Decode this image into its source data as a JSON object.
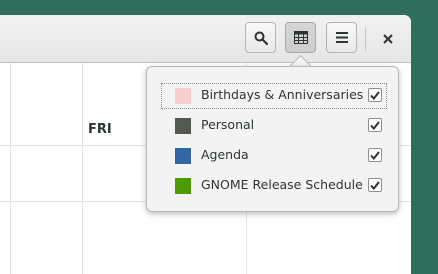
{
  "headerbar": {
    "search_icon": "search-icon",
    "calendars_icon": "calendar-grid-icon",
    "menu_icon": "hamburger-menu-icon",
    "close_icon": "close-icon",
    "calendars_button_active": true
  },
  "week_view": {
    "day_label": "FRI"
  },
  "calendars_popover": {
    "items": [
      {
        "label": "Birthdays & Anniversaries",
        "color": "#f8cdd0",
        "checked": true
      },
      {
        "label": "Personal",
        "color": "#555753",
        "checked": true
      },
      {
        "label": "Agenda",
        "color": "#3465a4",
        "checked": true
      },
      {
        "label": "GNOME Release Schedule",
        "color": "#4e9a06",
        "checked": true
      }
    ]
  },
  "colors": {
    "desktop_background": "#2f6e5c",
    "checkmark": "#2e3436"
  }
}
